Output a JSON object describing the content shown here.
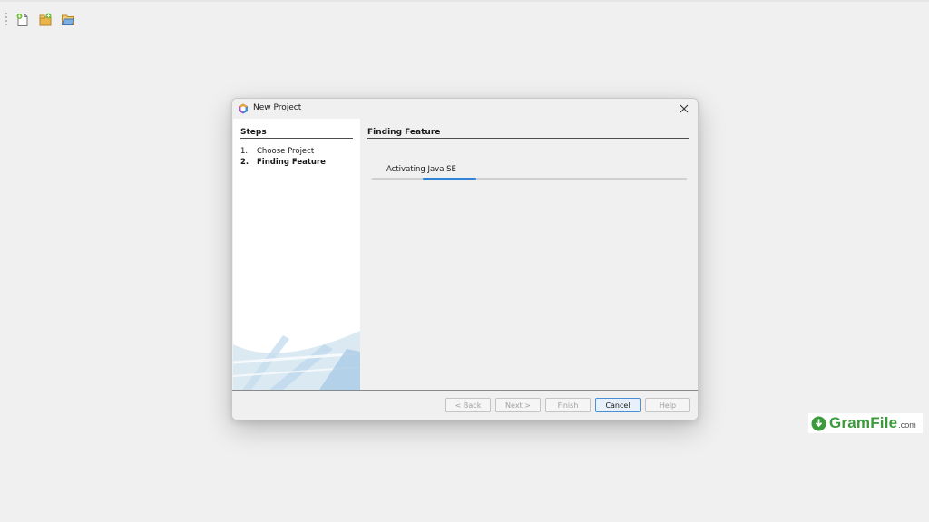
{
  "toolbar": {
    "icons": [
      "new-file-icon",
      "new-project-icon",
      "open-project-icon"
    ]
  },
  "dialog": {
    "title": "New Project",
    "steps_heading": "Steps",
    "steps": [
      {
        "number": "1.",
        "label": "Choose Project",
        "current": false
      },
      {
        "number": "2.",
        "label": "Finding Feature",
        "current": true
      }
    ],
    "content_heading": "Finding Feature",
    "activity_text": "Activating Java SE",
    "progress": {
      "indeterminate": true,
      "segment_start": 0.16,
      "segment_end": 0.33,
      "color": "#2f82d4"
    },
    "buttons": {
      "back": "< Back",
      "next": "Next >",
      "finish": "Finish",
      "cancel": "Cancel",
      "help": "Help"
    }
  },
  "branding": {
    "name": "GramFile",
    "suffix": ".com",
    "color": "#3b9a3b"
  }
}
